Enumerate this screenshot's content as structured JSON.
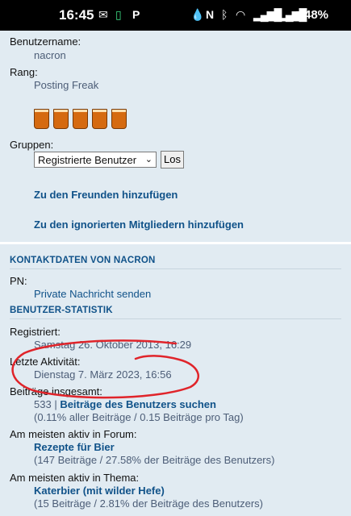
{
  "status": {
    "time": "16:45",
    "battery": "48%"
  },
  "profile": {
    "username_label": "Benutzername:",
    "username": "nacron",
    "rank_label": "Rang:",
    "rank": "Posting Freak",
    "groups_label": "Gruppen:",
    "group_selected": "Registrierte Benutzer",
    "go_label": "Los",
    "add_friend": "Zu den Freunden hinzufügen",
    "add_foe": "Zu den ignorierten Mitgliedern hinzufügen"
  },
  "contact": {
    "header": "KONTAKTDATEN VON NACRON",
    "pm_label": "PN:",
    "pm_link": "Private Nachricht senden"
  },
  "stats": {
    "header": "BENUTZER-STATISTIK",
    "registered_label": "Registriert:",
    "registered": "Samstag 26. Oktober 2013, 16:29",
    "last_active_label": "Letzte Aktivität:",
    "last_active": "Dienstag 7. März 2023, 16:56",
    "posts_label": "Beiträge insgesamt:",
    "posts_count": "533",
    "posts_sep": " | ",
    "posts_link": "Beiträge des Benutzers suchen",
    "posts_detail": "(0.11% aller Beiträge / 0.15 Beiträge pro Tag)",
    "forum_label": "Am meisten aktiv in Forum:",
    "forum_link": "Rezepte für Bier",
    "forum_detail": "(147 Beiträge / 27.58% der Beiträge des Benutzers)",
    "topic_label": "Am meisten aktiv in Thema:",
    "topic_link": "Katerbier (mit wilder Hefe)",
    "topic_detail": "(15 Beiträge / 2.81% der Beiträge des Benutzers)"
  },
  "colors": {
    "panel": "#e1ebf2",
    "link": "#105289",
    "annotation": "#e0242a"
  }
}
